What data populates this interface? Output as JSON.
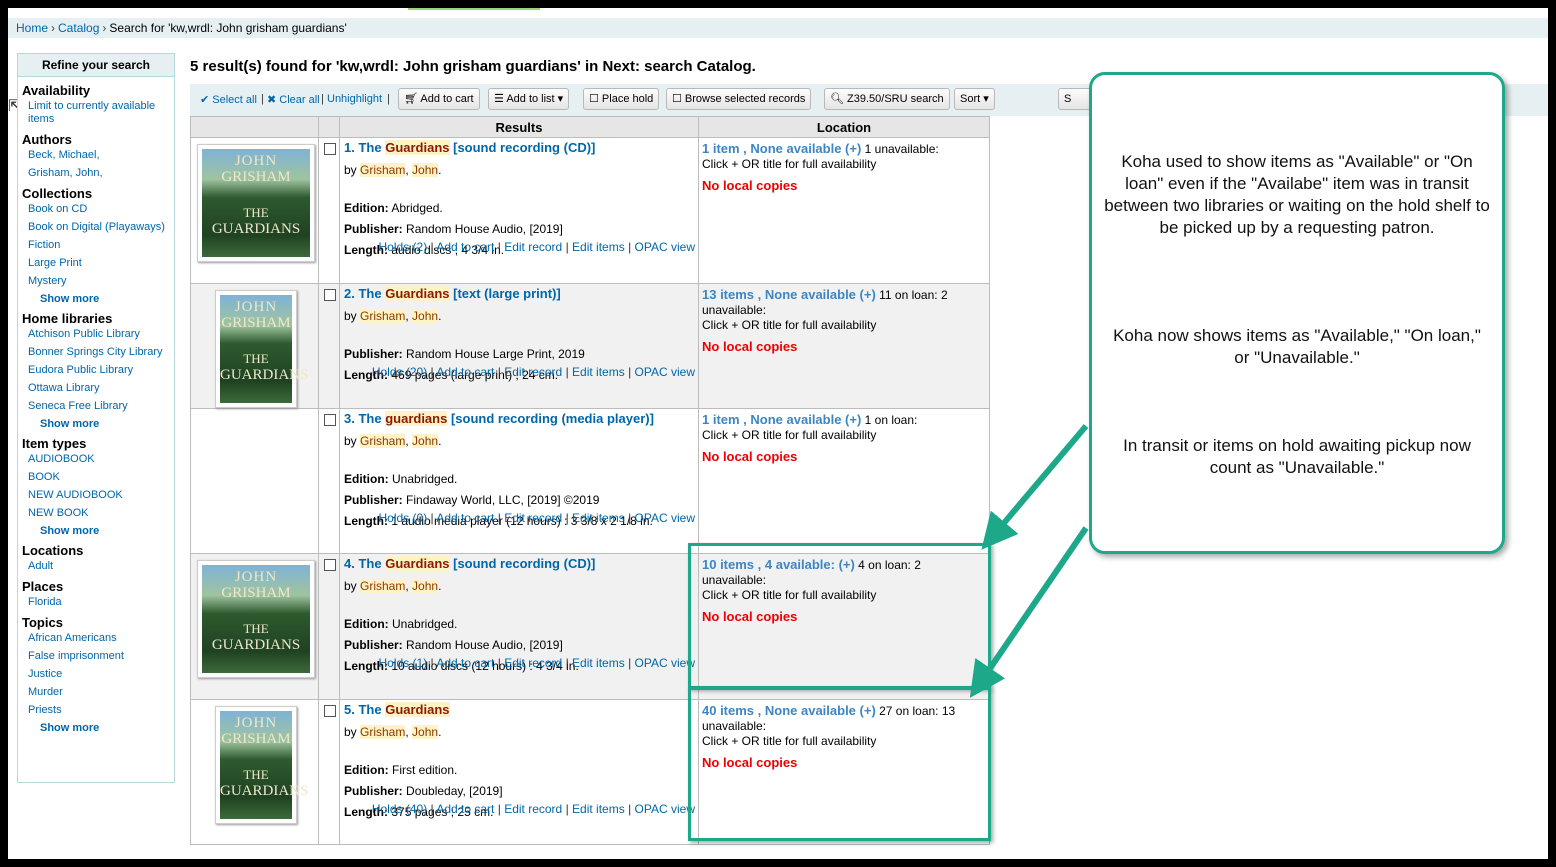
{
  "breadcrumb": {
    "home": "Home",
    "catalog": "Catalog",
    "current": "Search for 'kw,wrdl: John grisham guardians'",
    "sep": "›"
  },
  "sidebar": {
    "header": "Refine your search",
    "availability": {
      "title": "Availability",
      "item": "Limit to currently available items"
    },
    "authors": {
      "title": "Authors",
      "items": [
        "Beck, Michael,",
        "Grisham, John,"
      ]
    },
    "collections": {
      "title": "Collections",
      "items": [
        "Book on CD",
        "Book on Digital (Playaways)",
        "Fiction",
        "Large Print",
        "Mystery"
      ]
    },
    "home_libraries": {
      "title": "Home libraries",
      "items": [
        "Atchison Public Library",
        "Bonner Springs City Library",
        "Eudora Public Library",
        "Ottawa Library",
        "Seneca Free Library"
      ]
    },
    "item_types": {
      "title": "Item types",
      "items": [
        "AUDIOBOOK",
        "BOOK",
        "NEW AUDIOBOOK",
        "NEW BOOK"
      ]
    },
    "locations": {
      "title": "Locations",
      "items": [
        "Adult"
      ]
    },
    "places": {
      "title": "Places",
      "items": [
        "Florida"
      ]
    },
    "topics": {
      "title": "Topics",
      "items": [
        "African Americans",
        "False imprisonment",
        "Justice",
        "Murder",
        "Priests"
      ]
    },
    "show_more": "Show more"
  },
  "heading": "5 result(s) found for 'kw,wrdl: John grisham guardians' in Next: search Catalog.",
  "toolbar": {
    "select_all": "✔ Select all",
    "clear_all": "✖ Clear all",
    "unhighlight": "Unhighlight",
    "add_to_cart": "Add to cart",
    "add_to_list": "Add to list ▾",
    "place_hold": "Place hold",
    "browse": "Browse selected records",
    "z3950": "Z39.50/SRU search",
    "sort": "Sort ▾",
    "extra": "S"
  },
  "table": {
    "col_results": "Results",
    "col_location": "Location"
  },
  "cover": {
    "line1": "JOHN",
    "line2": "GRISHAM",
    "line3": "THE",
    "line4": "GUARDIANS"
  },
  "records": [
    {
      "num": "1.",
      "title_pre": "The ",
      "title_hl": "Guardians",
      "title_post": " [sound recording (CD)]",
      "by": "by ",
      "author_last": "Grisham",
      "author_first": "John",
      "fields": [
        {
          "k": "Edition:",
          "v": "Abridged."
        },
        {
          "k": "Publisher:",
          "v": "Random House Audio, [2019]"
        },
        {
          "k": "Length:",
          "v": "audio discs ; 4 3/4 in."
        }
      ],
      "holds": "Holds (2)",
      "avail": "1 item , None available (+)",
      "status": " 1 unavailable:",
      "click": "Click + OR title for full availability",
      "nolocal": "No local copies"
    },
    {
      "num": "2.",
      "title_pre": "The ",
      "title_hl": "Guardians",
      "title_post": " [text (large print)]",
      "by": "by ",
      "author_last": "Grisham",
      "author_first": "John",
      "fields": [
        {
          "k": "Publisher:",
          "v": "Random House Large Print, 2019"
        },
        {
          "k": "Length:",
          "v": "469 pages (large print) ; 24 cm."
        }
      ],
      "holds": "Holds (20)",
      "avail": "13 items , None available (+)",
      "status": " 11 on loan: 2 unavailable:",
      "click": "Click + OR title for full availability",
      "nolocal": "No local copies"
    },
    {
      "num": "3.",
      "title_pre": "The ",
      "title_hl": "guardians",
      "title_post": " [sound recording (media player)]",
      "by": "by ",
      "author_last": "Grisham",
      "author_first": "John",
      "fields": [
        {
          "k": "Edition:",
          "v": "Unabridged."
        },
        {
          "k": "Publisher:",
          "v": "Findaway World, LLC, [2019] ©2019"
        },
        {
          "k": "Length:",
          "v": "1 audio media player (12 hours) : 3 3/8 x 2 1/8 in."
        }
      ],
      "holds": "Holds (0)",
      "avail": "1 item , None available (+)",
      "status": " 1 on loan:",
      "click": "Click + OR title for full availability",
      "nolocal": "No local copies"
    },
    {
      "num": "4.",
      "title_pre": "The ",
      "title_hl": "Guardians",
      "title_post": " [sound recording (CD)]",
      "by": "by ",
      "author_last": "Grisham",
      "author_first": "John",
      "fields": [
        {
          "k": "Edition:",
          "v": "Unabridged."
        },
        {
          "k": "Publisher:",
          "v": "Random House Audio, [2019]"
        },
        {
          "k": "Length:",
          "v": "10 audio discs (12 hours) : 4 3/4 in."
        }
      ],
      "holds": "Holds (1)",
      "avail": "10 items , 4 available: (+)",
      "status": " 4 on loan: 2 unavailable:",
      "click": "Click + OR title for full availability",
      "nolocal": "No local copies"
    },
    {
      "num": "5.",
      "title_pre": "The ",
      "title_hl": "Guardians",
      "title_post": "",
      "by": "by ",
      "author_last": "Grisham",
      "author_first": "John",
      "fields": [
        {
          "k": "Edition:",
          "v": "First edition."
        },
        {
          "k": "Publisher:",
          "v": "Doubleday, [2019]"
        },
        {
          "k": "Length:",
          "v": "375 pages ; 25 cm."
        }
      ],
      "holds": "Holds (40)",
      "avail": "40 items , None available (+)",
      "status": " 27 on loan: 13 unavailable:",
      "click": "Click + OR title for full availability",
      "nolocal": "No local copies"
    }
  ],
  "actions": {
    "add_to_cart": "Add to cart",
    "edit_record": "Edit record",
    "edit_items": "Edit items",
    "opac_view": "OPAC view",
    "sep": "|"
  },
  "callout": {
    "p1": "Koha used to show items as \"Available\" or \"On loan\" even if the \"Availabe\" item was in transit between two libraries or waiting on the hold shelf to be picked up by a requesting patron.",
    "p2": "Koha now shows items as \"Available,\" \"On loan,\" or \"Unavailable.\"",
    "p3": "In transit or items on hold awaiting pickup now count as \"Unavailable.\""
  },
  "colors": {
    "accent": "#1ea88a",
    "link": "#0066a8",
    "available": "#3c86c4",
    "no_local": "#e00000"
  }
}
